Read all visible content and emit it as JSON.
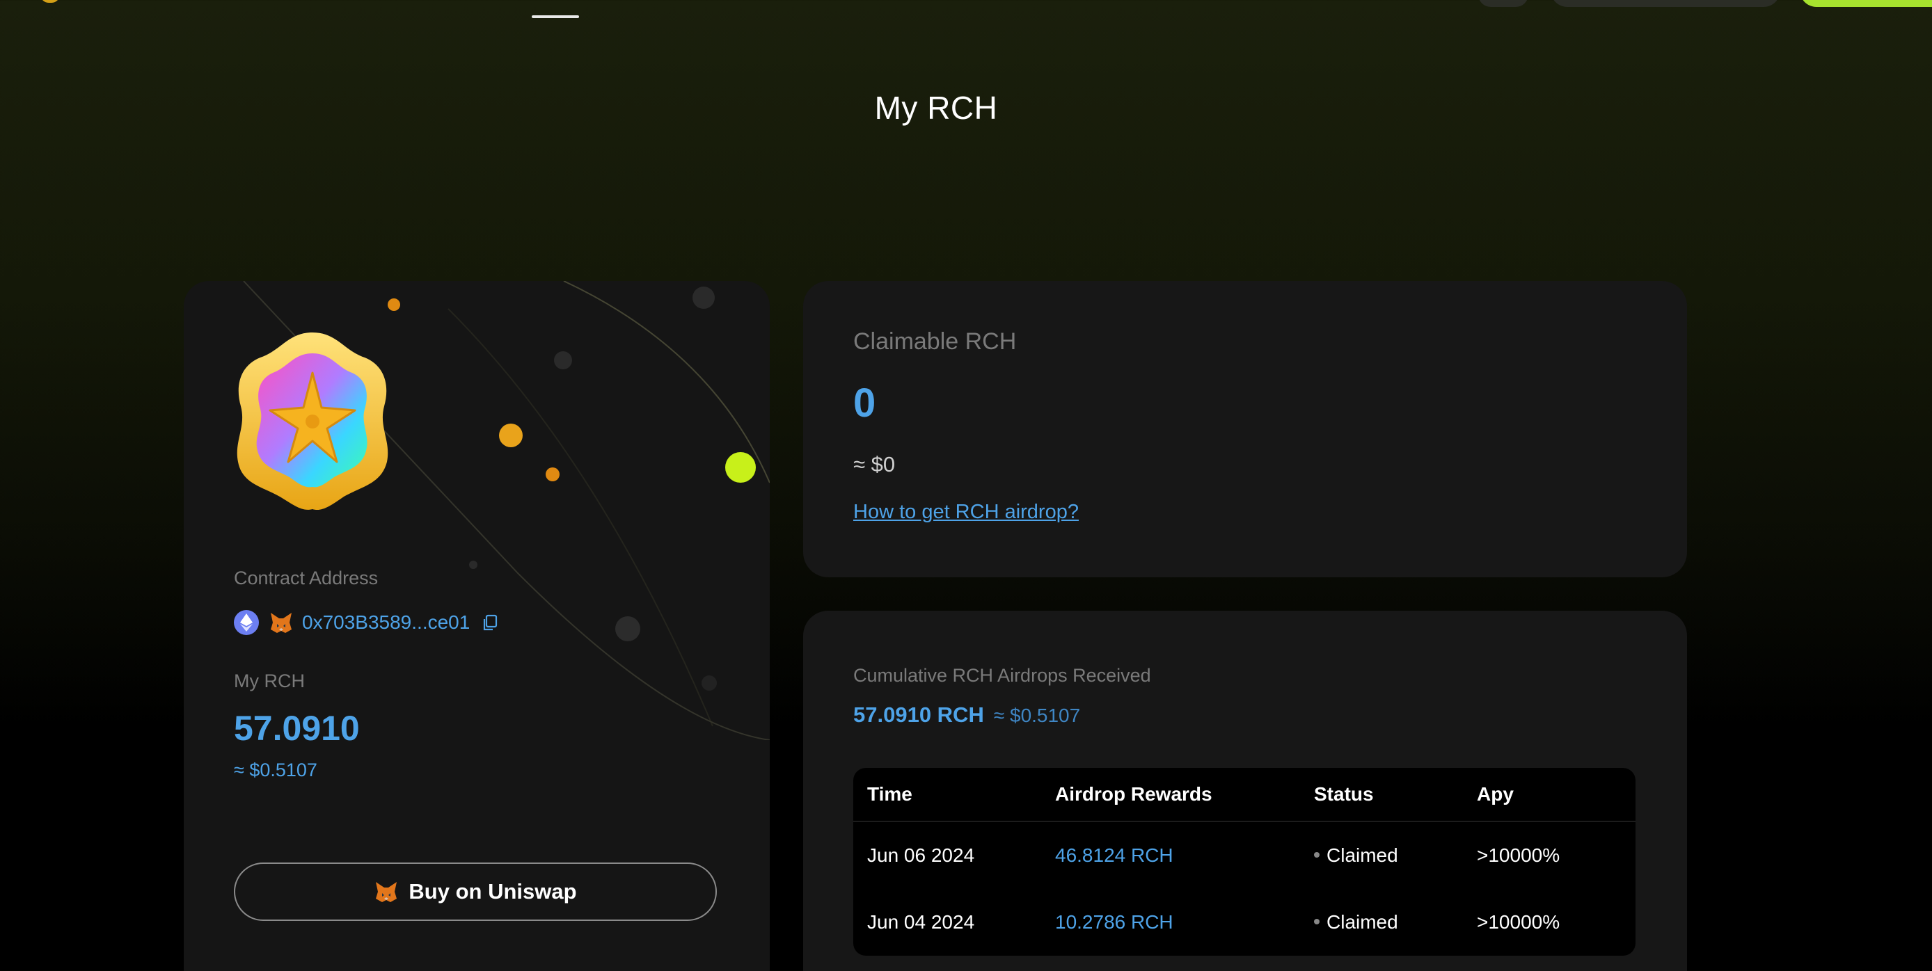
{
  "page": {
    "title": "My RCH"
  },
  "colors": {
    "accent": "#4ea3e8",
    "lime": "#a6e22e",
    "card": "#161616"
  },
  "token_card": {
    "badge_icon": "star-badge-icon",
    "contract_label": "Contract Address",
    "contract_address": "0x703B3589...ce01",
    "my_rch_label": "My RCH",
    "my_rch_value": "57.0910",
    "my_rch_usd": "≈ $0.5107",
    "buy_button_label": "Buy on Uniswap"
  },
  "claimable": {
    "label": "Claimable RCH",
    "value": "0",
    "usd": "≈ $0",
    "help_link": "How to get RCH airdrop?"
  },
  "cumulative": {
    "label": "Cumulative RCH Airdrops Received",
    "value": "57.0910 RCH",
    "usd": "≈ $0.5107",
    "table": {
      "headers": [
        "Time",
        "Airdrop Rewards",
        "Status",
        "Apy"
      ],
      "rows": [
        {
          "time": "Jun 06 2024",
          "reward": "46.8124 RCH",
          "status": "Claimed",
          "apy": ">10000%"
        },
        {
          "time": "Jun 04 2024",
          "reward": "10.2786 RCH",
          "status": "Claimed",
          "apy": ">10000%"
        }
      ]
    }
  }
}
